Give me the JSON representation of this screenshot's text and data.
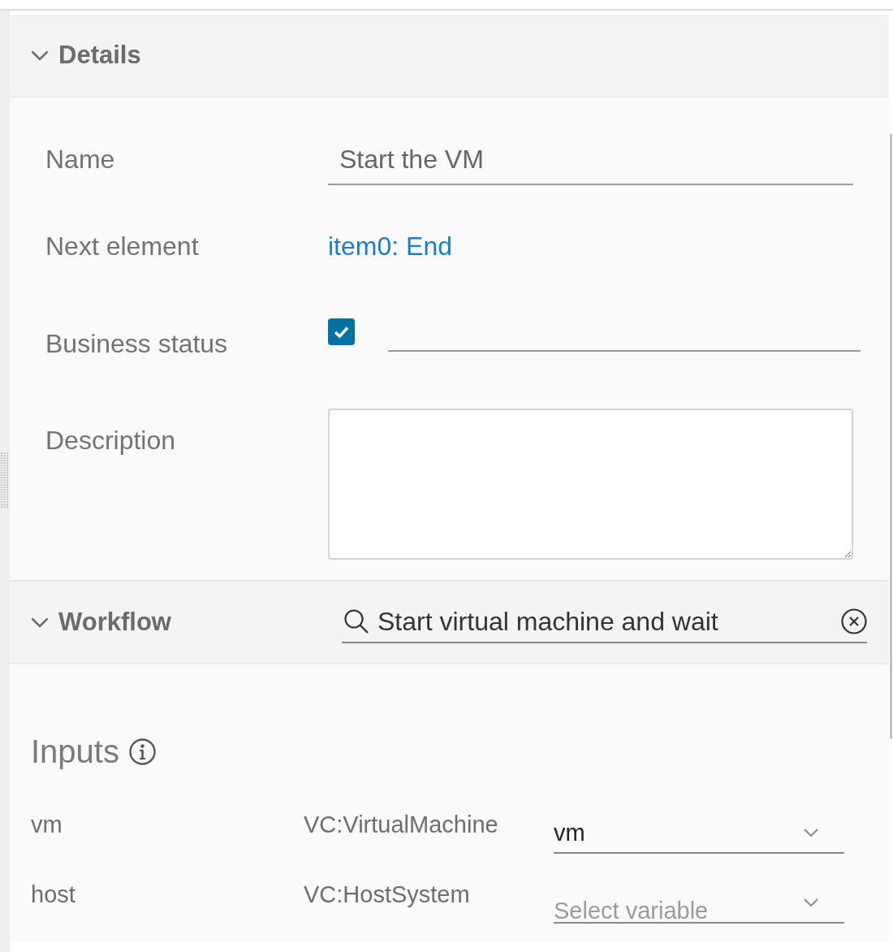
{
  "details": {
    "title": "Details",
    "expanded": true,
    "fields": [
      {
        "kind": "text",
        "label": "Name",
        "value": "Start the VM"
      },
      {
        "kind": "link",
        "label": "Next element",
        "value": "item0: End"
      },
      {
        "kind": "checkbox",
        "label": "Business status",
        "checked": true
      },
      {
        "kind": "textarea",
        "label": "Description"
      }
    ]
  },
  "workflow": {
    "title": "Workflow",
    "expanded": true,
    "search": {
      "value": "Start virtual machine and wait"
    },
    "inputs_title": "Inputs",
    "inputs": [
      {
        "name": "vm",
        "type": "VC:VirtualMachine",
        "value": "vm"
      },
      {
        "name": "host",
        "type": "VC:HostSystem",
        "placeholder": "Select variable"
      }
    ]
  }
}
